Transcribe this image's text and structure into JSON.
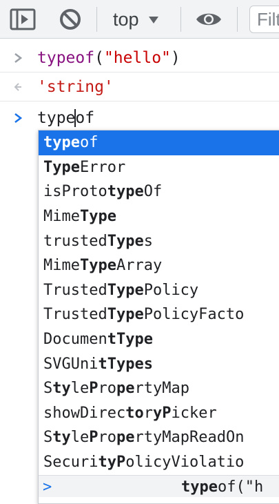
{
  "toolbar": {
    "context": "top",
    "filter_placeholder": "Filter",
    "colors": {
      "background": "#f1f3f4",
      "icon": "#5f6368"
    },
    "icons": [
      "sidebar-toggle-icon",
      "clear-console-icon",
      "caret-down-icon",
      "eye-icon"
    ]
  },
  "console": {
    "entry1": {
      "keyword": "typeof",
      "open_paren": "(",
      "string": "\"hello\"",
      "close_paren": ")"
    },
    "result1": "'string'",
    "input": {
      "before_cursor": "type",
      "after_cursor": "of"
    }
  },
  "autocomplete": {
    "selected_index": 0,
    "selected_color": "#1a73e8",
    "items": [
      {
        "bold": "type",
        "rest": "of"
      },
      {
        "bold": "Type",
        "rest": "Error"
      },
      {
        "pre": "isProto",
        "bold": "type",
        "rest": "Of"
      },
      {
        "pre": "Mime",
        "bold": "Type",
        "rest": ""
      },
      {
        "pre": "trusted",
        "bold": "Type",
        "rest": "s"
      },
      {
        "pre": "Mime",
        "bold": "Type",
        "rest": "Array"
      },
      {
        "pre": "Trusted",
        "bold": "Type",
        "rest": "Policy"
      },
      {
        "pre": "Trusted",
        "bold": "Type",
        "rest": "PolicyFacto"
      },
      {
        "segments": [
          [
            "Documen",
            false
          ],
          [
            "tType",
            true
          ]
        ]
      },
      {
        "segments": [
          [
            "SVGUni",
            false
          ],
          [
            "tTypes",
            true
          ]
        ]
      },
      {
        "segments": [
          [
            "S",
            false
          ],
          [
            "ty",
            true
          ],
          [
            "le",
            false
          ],
          [
            "P",
            true
          ],
          [
            "ro",
            false
          ],
          [
            "pe",
            true
          ],
          [
            "rtyMap",
            false
          ]
        ]
      },
      {
        "segments": [
          [
            "showDirec",
            false
          ],
          [
            "to",
            true
          ],
          [
            "r",
            false
          ],
          [
            "yP",
            true
          ],
          [
            "icker",
            false
          ]
        ]
      },
      {
        "segments": [
          [
            "S",
            false
          ],
          [
            "ty",
            true
          ],
          [
            "le",
            false
          ],
          [
            "P",
            true
          ],
          [
            "ro",
            false
          ],
          [
            "pe",
            true
          ],
          [
            "rtyMapReadOn",
            false
          ]
        ]
      },
      {
        "segments": [
          [
            "Securi",
            false
          ],
          [
            "tyP",
            true
          ],
          [
            "olicyViolatio",
            false
          ]
        ]
      }
    ]
  },
  "history_line": {
    "prompt": ">",
    "bold": "type",
    "rest": "of(\"h"
  }
}
